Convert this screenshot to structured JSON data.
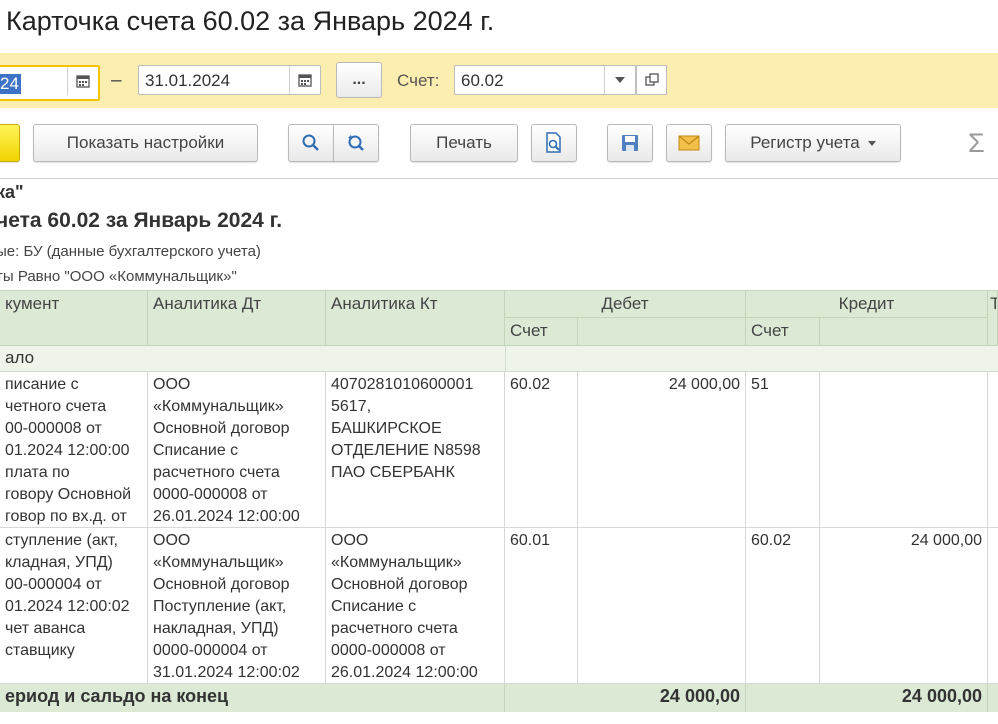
{
  "window": {
    "title": "Карточка счета 60.02 за Январь 2024 г."
  },
  "filters": {
    "start_date": "24",
    "dash": "–",
    "end_date": "31.01.2024",
    "more_label": "...",
    "account_label": "Счет:",
    "account_value": "60.02"
  },
  "toolbar": {
    "settings_label": "Показать настройки",
    "print_label": "Печать",
    "register_label": "Регистр учета",
    "sigma": "Σ"
  },
  "report": {
    "org": "ка\"",
    "title": "чета 60.02 за Январь 2024 г.",
    "data_line": "ые: БУ (данные бухгалтерского учета)",
    "filter_line": "ты Равно \"ООО «Коммунальщик»\""
  },
  "table": {
    "headers": {
      "document": "кумент",
      "analytics_dt": "Аналитика Дт",
      "analytics_kt": "Аналитика Кт",
      "debit": "Дебет",
      "credit": "Кредит",
      "debit_account": "Счет",
      "credit_account": "Счет",
      "extra": "Т"
    },
    "opening_label": "ало",
    "rows": [
      {
        "document": "писание с\nчетного счета\n00-000008 от\n01.2024 12:00:00\nплата по\nговору Основной\nговор по вх.д.  от",
        "analytics_dt": "ООО\n«Коммунальщик»\nОсновной договор\nСписание с\nрасчетного счета\n0000-000008 от\n26.01.2024 12:00:00",
        "analytics_kt": "4070281010600001\n5617,\nБАШКИРСКОЕ\nОТДЕЛЕНИЕ N8598\nПАО СБЕРБАНК",
        "debit_account": "60.02",
        "debit_amount": "24 000,00",
        "credit_account": "51",
        "credit_amount": ""
      },
      {
        "document": "ступление (акт,\nкладная, УПД)\n00-000004 от\n01.2024 12:00:02\nчет аванса\nставщику",
        "analytics_dt": "ООО\n«Коммунальщик»\nОсновной договор\nПоступление (акт,\nнакладная, УПД)\n0000-000004 от\n31.01.2024 12:00:02",
        "analytics_kt": "ООО\n«Коммунальщик»\nОсновной договор\nСписание с\nрасчетного счета\n0000-000008 от\n26.01.2024 12:00:00",
        "debit_account": "60.01",
        "debit_amount": "",
        "credit_account": "60.02",
        "credit_amount": "24 000,00"
      }
    ],
    "totals": {
      "label": "ериод и сальдо на конец",
      "debit": "24 000,00",
      "credit": "24 000,00"
    }
  },
  "colors": {
    "filter_bar": "#fbeeb0",
    "header_bg": "#dce9d5",
    "selection": "#3d73c6",
    "yellow_button": "#f1d400"
  }
}
